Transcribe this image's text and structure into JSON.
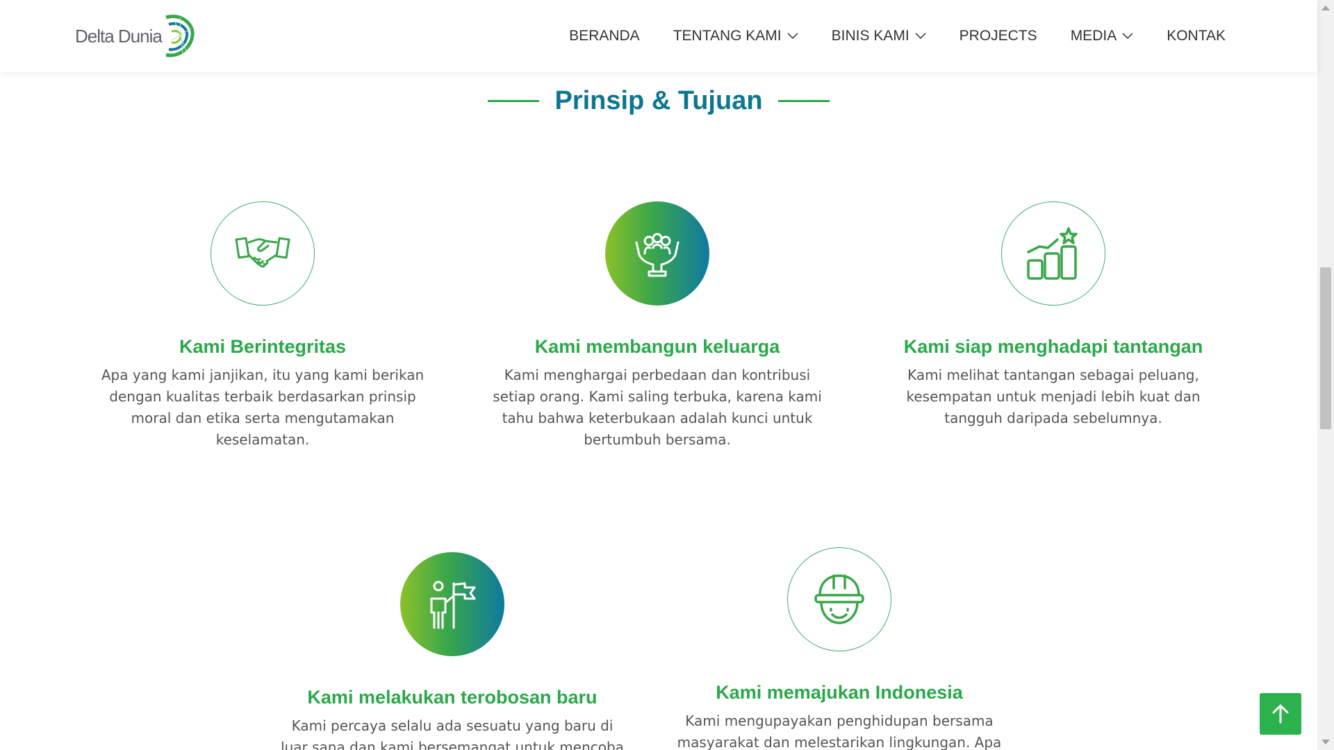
{
  "header": {
    "logo_text": "Delta Dunia",
    "nav": [
      {
        "label": "BERANDA",
        "has_dropdown": false
      },
      {
        "label": "TENTANG KAMI",
        "has_dropdown": true
      },
      {
        "label": "BINIS KAMI",
        "has_dropdown": true
      },
      {
        "label": "PROJECTS",
        "has_dropdown": false
      },
      {
        "label": "MEDIA",
        "has_dropdown": true
      },
      {
        "label": "KONTAK",
        "has_dropdown": false
      }
    ]
  },
  "section": {
    "title": "Prinsip & Tujuan"
  },
  "cards": [
    {
      "icon": "handshake-icon",
      "title": "Kami Berintegritas",
      "desc": "Apa yang kami janjikan, itu yang kami berikan dengan kualitas terbaik berdasarkan prinsip moral dan etika serta mengutamakan keselamatan."
    },
    {
      "icon": "family-in-hands-icon",
      "title": "Kami membangun keluarga",
      "desc": "Kami menghargai perbedaan dan kontribusi setiap orang. Kami saling terbuka, karena kami tahu bahwa keterbukaan adalah kunci untuk bertumbuh bersama."
    },
    {
      "icon": "growth-chart-star-icon",
      "title": "Kami siap menghadapi tantangan",
      "desc": "Kami melihat tantangan sebagai peluang, kesempatan untuk menjadi lebih kuat dan tangguh daripada sebelumnya."
    },
    {
      "icon": "person-with-flag-icon",
      "title": "Kami melakukan terobosan baru",
      "desc": "Kami percaya selalu ada sesuatu yang baru di luar sana dan kami bersemangat untuk mencoba"
    },
    {
      "icon": "worker-helmet-icon",
      "title": "Kami memajukan Indonesia",
      "desc": "Kami mengupayakan penghidupan bersama masyarakat dan melestarikan lingkungan. Apa yang"
    }
  ],
  "colors": {
    "accent_green": "#2aa84a",
    "title_blue": "#0c7691",
    "button_green": "#2bb24c"
  }
}
